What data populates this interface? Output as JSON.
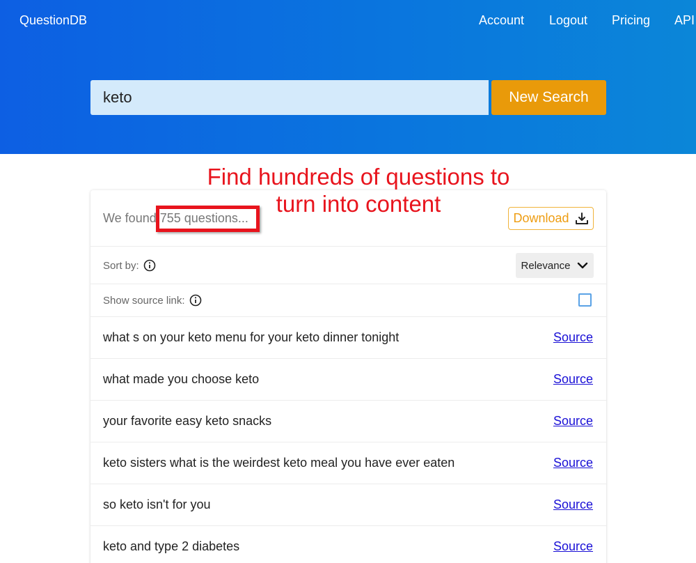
{
  "header": {
    "brand": "QuestionDB",
    "nav": [
      "Account",
      "Logout",
      "Pricing",
      "API"
    ]
  },
  "search": {
    "value": "keto",
    "button_label": "New Search"
  },
  "annotation": {
    "line1": "Find hundreds of questions to",
    "line2": "turn into content",
    "color": "#e8141d"
  },
  "results": {
    "prefix": "We found",
    "count": "755 questions...",
    "download_label": "Download",
    "sort_label": "Sort by:",
    "sort_value": "Relevance",
    "show_source_label": "Show source link:",
    "show_source_checked": false,
    "link_label": "Source",
    "questions": [
      "what s on your keto menu for your keto dinner tonight",
      "what made you choose keto",
      "your favorite easy keto snacks",
      "keto sisters what is the weirdest keto meal you have ever eaten",
      "so keto isn't for you",
      "keto and type 2 diabetes"
    ]
  },
  "colors": {
    "accent": "#e99a0a",
    "brand_blue": "#0d5fe3",
    "link": "#1a10d6"
  },
  "icons": {
    "download": "download-icon",
    "info": "info-icon",
    "chevron": "chevron-down-icon"
  }
}
